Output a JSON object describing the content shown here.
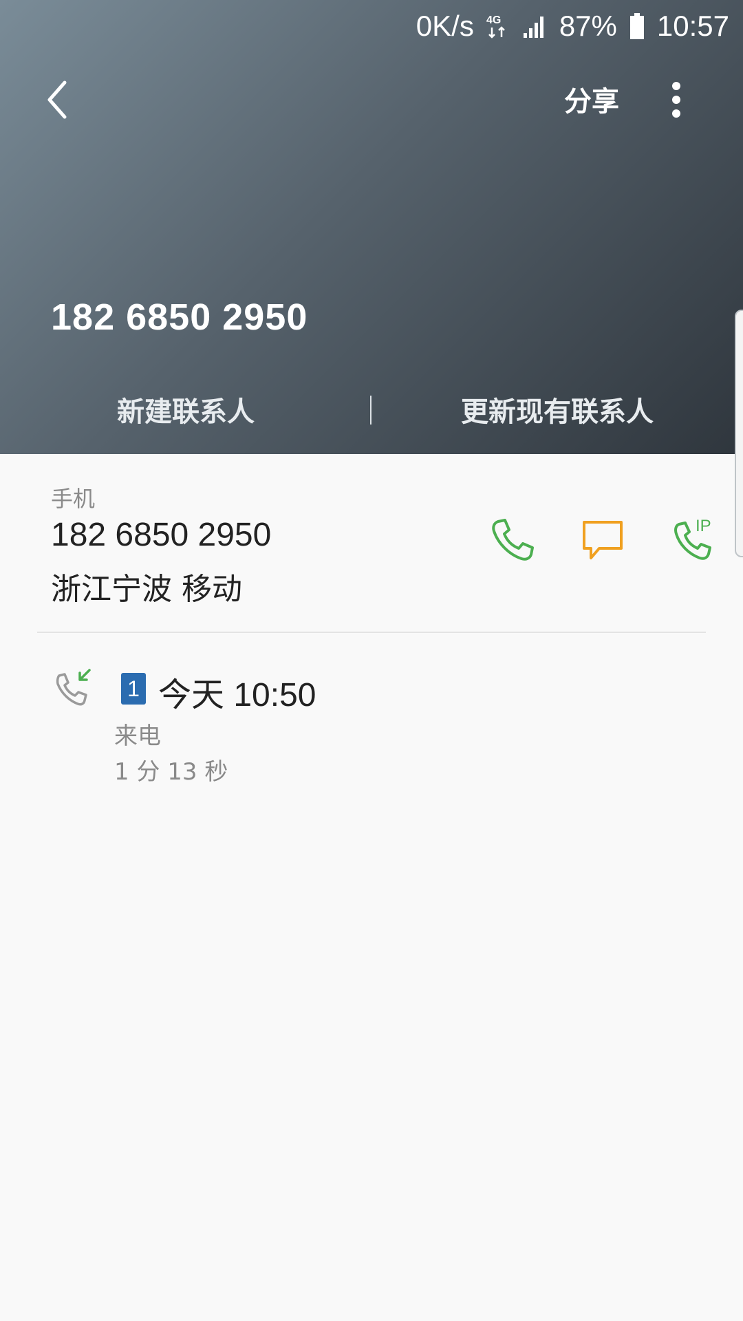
{
  "status_bar": {
    "net_speed": "0K/s",
    "network": "4G",
    "battery": "87%",
    "time": "10:57"
  },
  "header": {
    "share_label": "分享",
    "title": "182 6850 2950",
    "new_contact_label": "新建联系人",
    "update_contact_label": "更新现有联系人"
  },
  "contact": {
    "type_label": "手机",
    "number": "182 6850 2950",
    "location": "浙江宁波 移动",
    "ip_label": "IP"
  },
  "call_log": {
    "sim": "1",
    "date": "今天 10:50",
    "type": "来电",
    "duration": "1 分 13 秒"
  },
  "colors": {
    "call_green": "#4caf50",
    "message_orange": "#f0a020",
    "sim_blue": "#2b6cb0"
  }
}
